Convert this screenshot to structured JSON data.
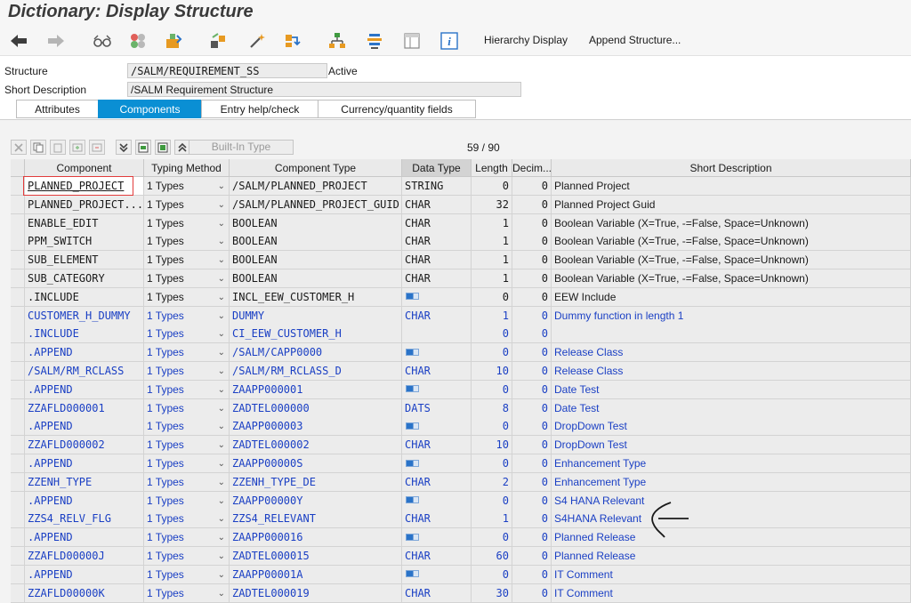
{
  "window": {
    "title": "Dictionary: Display Structure"
  },
  "toolbar": {
    "hierarchy_display": "Hierarchy Display",
    "append_structure": "Append Structure..."
  },
  "header": {
    "structure_label": "Structure",
    "structure_value": "/SALM/REQUIREMENT_SS",
    "status": "Active",
    "short_desc_label": "Short Description",
    "short_desc_value": "/SALM Requirement Structure"
  },
  "tabs": [
    "Attributes",
    "Components",
    "Entry help/check",
    "Currency/quantity fields"
  ],
  "grid_toolbar": {
    "builtin_type": "Built-In Type",
    "counter": "59 / 90"
  },
  "columns": [
    "Component",
    "Typing Method",
    "Component Type",
    "Data Type",
    "Length",
    "Decim...",
    "Short Description"
  ],
  "rows": [
    {
      "c": "PLANNED_PROJECT",
      "m": "1 Types",
      "t": "/SALM/PLANNED_PROJECT",
      "d": "STRING",
      "l": "0",
      "dec": "0",
      "s": "Planned Project",
      "blue": false,
      "icon": false
    },
    {
      "c": "PLANNED_PROJECT...",
      "m": "1 Types",
      "t": "/SALM/PLANNED_PROJECT_GUID",
      "d": "CHAR",
      "l": "32",
      "dec": "0",
      "s": "Planned Project Guid",
      "blue": false,
      "icon": false
    },
    {
      "c": "ENABLE_EDIT",
      "m": "1 Types",
      "t": "BOOLEAN",
      "d": "CHAR",
      "l": "1",
      "dec": "0",
      "s": "Boolean Variable (X=True, -=False, Space=Unknown)",
      "blue": false,
      "icon": false
    },
    {
      "c": "PPM_SWITCH",
      "m": "1 Types",
      "t": "BOOLEAN",
      "d": "CHAR",
      "l": "1",
      "dec": "0",
      "s": "Boolean Variable (X=True, -=False, Space=Unknown)",
      "blue": false,
      "icon": false
    },
    {
      "c": "SUB_ELEMENT",
      "m": "1 Types",
      "t": "BOOLEAN",
      "d": "CHAR",
      "l": "1",
      "dec": "0",
      "s": "Boolean Variable (X=True, -=False, Space=Unknown)",
      "blue": false,
      "icon": false
    },
    {
      "c": "SUB_CATEGORY",
      "m": "1 Types",
      "t": "BOOLEAN",
      "d": "CHAR",
      "l": "1",
      "dec": "0",
      "s": "Boolean Variable (X=True, -=False, Space=Unknown)",
      "blue": false,
      "icon": false
    },
    {
      "c": ".INCLUDE",
      "m": "1 Types",
      "t": "INCL_EEW_CUSTOMER_H",
      "d": "",
      "l": "0",
      "dec": "0",
      "s": "EEW Include",
      "blue": false,
      "icon": true
    },
    {
      "c": "CUSTOMER_H_DUMMY",
      "m": "1 Types",
      "t": "DUMMY",
      "d": "CHAR",
      "l": "1",
      "dec": "0",
      "s": "Dummy function in length 1",
      "blue": true,
      "icon": false
    },
    {
      "c": ".INCLUDE",
      "m": "1 Types",
      "t": "CI_EEW_CUSTOMER_H",
      "d": "",
      "l": "0",
      "dec": "0",
      "s": "",
      "blue": true,
      "icon": false
    },
    {
      "c": ".APPEND",
      "m": "1 Types",
      "t": "/SALM/CAPP0000",
      "d": "",
      "l": "0",
      "dec": "0",
      "s": "Release Class",
      "blue": true,
      "icon": true
    },
    {
      "c": "/SALM/RM_RCLASS",
      "m": "1 Types",
      "t": "/SALM/RM_RCLASS_D",
      "d": "CHAR",
      "l": "10",
      "dec": "0",
      "s": "Release Class",
      "blue": true,
      "icon": false
    },
    {
      "c": ".APPEND",
      "m": "1 Types",
      "t": "ZAAPP000001",
      "d": "",
      "l": "0",
      "dec": "0",
      "s": "Date Test",
      "blue": true,
      "icon": true
    },
    {
      "c": "ZZAFLD000001",
      "m": "1 Types",
      "t": "ZADTEL000000",
      "d": "DATS",
      "l": "8",
      "dec": "0",
      "s": "Date Test",
      "blue": true,
      "icon": false
    },
    {
      "c": ".APPEND",
      "m": "1 Types",
      "t": "ZAAPP000003",
      "d": "",
      "l": "0",
      "dec": "0",
      "s": "DropDown Test",
      "blue": true,
      "icon": true
    },
    {
      "c": "ZZAFLD000002",
      "m": "1 Types",
      "t": "ZADTEL000002",
      "d": "CHAR",
      "l": "10",
      "dec": "0",
      "s": "DropDown Test",
      "blue": true,
      "icon": false
    },
    {
      "c": ".APPEND",
      "m": "1 Types",
      "t": "ZAAPP00000S",
      "d": "",
      "l": "0",
      "dec": "0",
      "s": "Enhancement Type",
      "blue": true,
      "icon": true
    },
    {
      "c": "ZZENH_TYPE",
      "m": "1 Types",
      "t": "ZZENH_TYPE_DE",
      "d": "CHAR",
      "l": "2",
      "dec": "0",
      "s": "Enhancement Type",
      "blue": true,
      "icon": false
    },
    {
      "c": ".APPEND",
      "m": "1 Types",
      "t": "ZAAPP00000Y",
      "d": "",
      "l": "0",
      "dec": "0",
      "s": "S4 HANA Relevant",
      "blue": true,
      "icon": true
    },
    {
      "c": "ZZS4_RELV_FLG",
      "m": "1 Types",
      "t": "ZZS4_RELEVANT",
      "d": "CHAR",
      "l": "1",
      "dec": "0",
      "s": "S4HANA Relevant",
      "blue": true,
      "icon": false
    },
    {
      "c": ".APPEND",
      "m": "1 Types",
      "t": "ZAAPP000016",
      "d": "",
      "l": "0",
      "dec": "0",
      "s": "Planned Release",
      "blue": true,
      "icon": true
    },
    {
      "c": "ZZAFLD00000J",
      "m": "1 Types",
      "t": "ZADTEL000015",
      "d": "CHAR",
      "l": "60",
      "dec": "0",
      "s": "Planned Release",
      "blue": true,
      "icon": false
    },
    {
      "c": ".APPEND",
      "m": "1 Types",
      "t": "ZAAPP00001A",
      "d": "",
      "l": "0",
      "dec": "0",
      "s": "IT Comment",
      "blue": true,
      "icon": true
    },
    {
      "c": "ZZAFLD00000K",
      "m": "1 Types",
      "t": "ZADTEL000019",
      "d": "CHAR",
      "l": "30",
      "dec": "0",
      "s": "IT Comment",
      "blue": true,
      "icon": false
    }
  ]
}
